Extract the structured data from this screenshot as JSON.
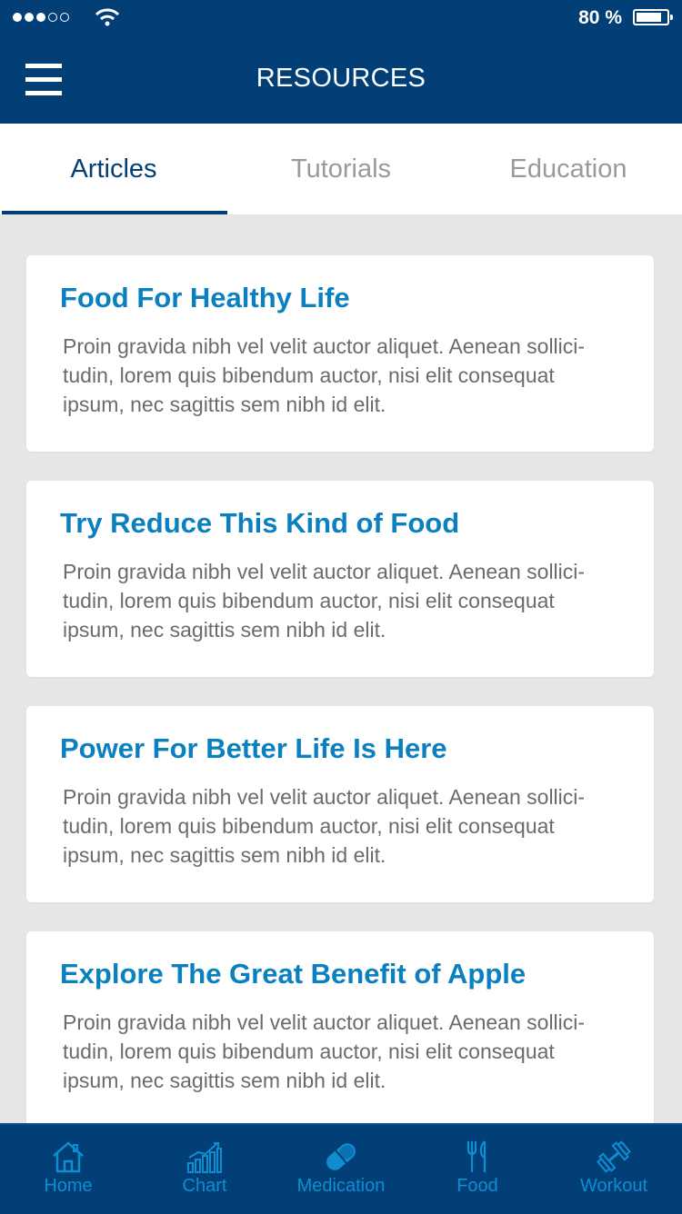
{
  "status": {
    "battery": "80 %",
    "battery_level": 0.8
  },
  "header": {
    "title": "RESOURCES"
  },
  "tabs": [
    {
      "label": "Articles",
      "active": true
    },
    {
      "label": "Tutorials",
      "active": false
    },
    {
      "label": "Education",
      "active": false
    }
  ],
  "articles": [
    {
      "title": "Food For Healthy Life",
      "body": "Proin gravida nibh vel velit auctor aliquet. Aenean sollici-tudin, lorem quis bibendum auctor, nisi elit consequat ipsum, nec sagittis sem nibh id elit."
    },
    {
      "title": "Try Reduce This Kind of Food",
      "body": "Proin gravida nibh vel velit auctor aliquet. Aenean sollici-tudin, lorem quis bibendum auctor, nisi elit consequat ipsum, nec sagittis sem nibh id elit."
    },
    {
      "title": "Power For Better Life Is Here",
      "body": "Proin gravida nibh vel velit auctor aliquet. Aenean sollici-tudin, lorem quis bibendum auctor, nisi elit consequat ipsum, nec sagittis sem nibh id elit."
    },
    {
      "title": "Explore The Great Benefit of Apple",
      "body": "Proin gravida nibh vel velit auctor aliquet. Aenean sollici-tudin, lorem quis bibendum auctor, nisi elit consequat ipsum, nec sagittis sem nibh id elit."
    }
  ],
  "tabbar": [
    {
      "label": "Home",
      "icon": "home-icon"
    },
    {
      "label": "Chart",
      "icon": "chart-icon"
    },
    {
      "label": "Medication",
      "icon": "pill-icon"
    },
    {
      "label": "Food",
      "icon": "fork-knife-icon"
    },
    {
      "label": "Workout",
      "icon": "dumbbell-icon"
    }
  ],
  "colors": {
    "primary": "#033f77",
    "accent": "#0a80c0",
    "tab_icon": "#0e8ed0"
  }
}
